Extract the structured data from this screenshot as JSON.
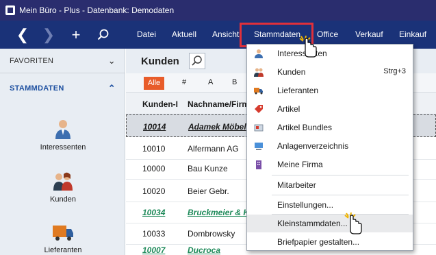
{
  "window": {
    "title": "Mein Büro - Plus - Datenbank: Demodaten"
  },
  "nav": {
    "back": "❮",
    "forward": "❯",
    "add": "+",
    "menu": [
      "Datei",
      "Aktuell",
      "Ansicht",
      "Stammdaten",
      "Office",
      "Verkauf",
      "Einkauf"
    ]
  },
  "sidebar": {
    "favorites": "FAVORITEN",
    "stammdaten": "STAMMDATEN",
    "items": [
      "Interessenten",
      "Kunden",
      "Lieferanten"
    ]
  },
  "content": {
    "title": "Kunden",
    "alpha_all": "Alle",
    "alpha": [
      "#",
      "A",
      "B"
    ],
    "columns": [
      "Kunden-I",
      "Nachname/Firm"
    ],
    "rows": [
      {
        "id": "10014",
        "name": "Adamek Möbel"
      },
      {
        "id": "10010",
        "name": "Alfermann AG"
      },
      {
        "id": "10000",
        "name": "Bau Kunze"
      },
      {
        "id": "10020",
        "name": "Beier Gebr."
      },
      {
        "id": "10034",
        "name": "Bruckmeier & K"
      },
      {
        "id": "10033",
        "name": "Dombrowsky"
      },
      {
        "id": "10007",
        "name": "Ducroca"
      }
    ]
  },
  "dropdown": {
    "items": [
      {
        "label": "Interessenten",
        "shortcut": ""
      },
      {
        "label": "Kunden",
        "shortcut": "Strg+3"
      },
      {
        "label": "Lieferanten",
        "shortcut": ""
      },
      {
        "label": "Artikel",
        "shortcut": ""
      },
      {
        "label": "Artikel Bundles",
        "shortcut": ""
      },
      {
        "label": "Anlagenverzeichnis",
        "shortcut": ""
      },
      {
        "label": "Meine Firma",
        "shortcut": ""
      },
      {
        "label": "Mitarbeiter",
        "shortcut": ""
      },
      {
        "label": "Einstellungen...",
        "shortcut": ""
      },
      {
        "label": "Kleinstammdaten...",
        "shortcut": ""
      },
      {
        "label": "Briefpapier gestalten...",
        "shortcut": ""
      }
    ]
  },
  "colors": {
    "titlebar": "#2a2d6e",
    "navbar": "#1a3278",
    "accent": "#e85c2a",
    "highlight": "#e0303a",
    "link_green": "#1f8a5a"
  }
}
